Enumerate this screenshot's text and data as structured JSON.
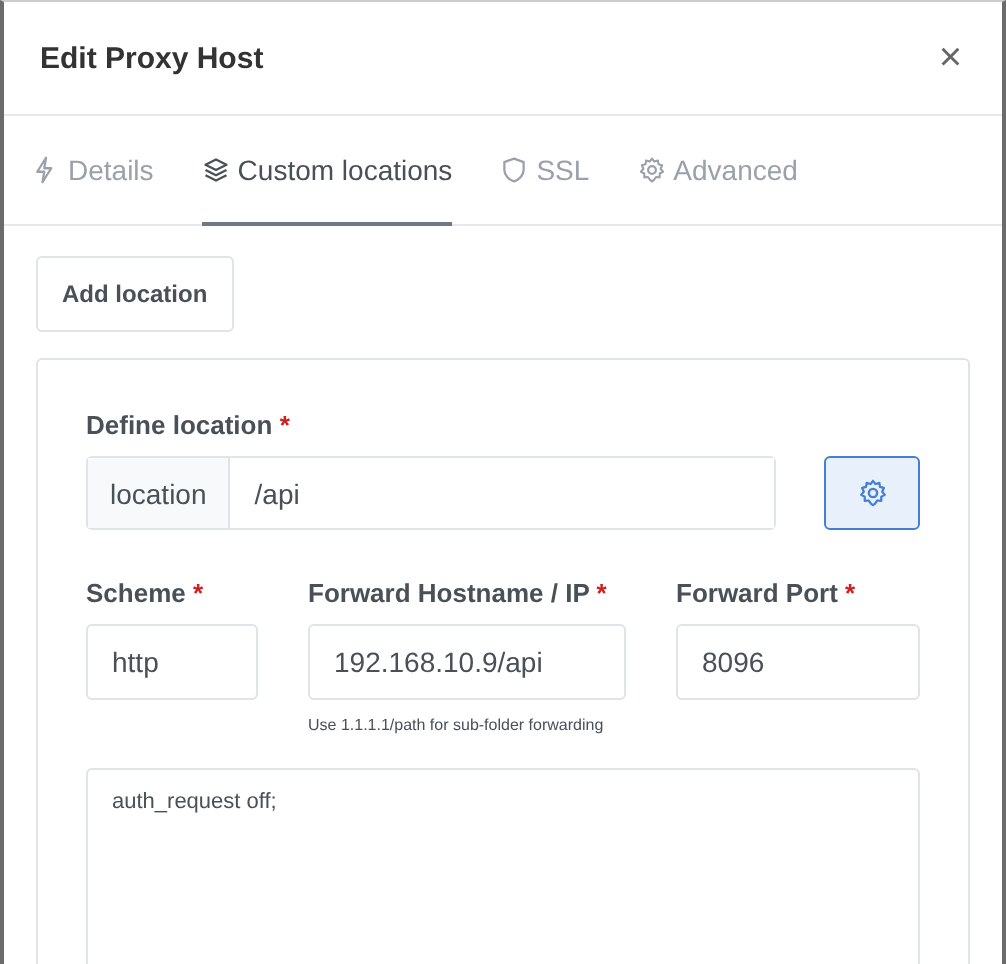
{
  "window": {
    "title": "Edit Proxy Host",
    "close": "×"
  },
  "tabs": [
    {
      "label": "Details",
      "selected": false
    },
    {
      "label": "Custom locations",
      "selected": true
    },
    {
      "label": "SSL",
      "selected": false
    },
    {
      "label": "Advanced",
      "selected": false
    }
  ],
  "add_button": "Add location",
  "location": {
    "label": "Define location",
    "required": "*",
    "prefix": "location",
    "value": "/api"
  },
  "fields": [
    {
      "label": "Scheme",
      "required": "*",
      "value": "http"
    },
    {
      "label": "Forward Hostname / IP",
      "required": "*",
      "value": "192.168.10.9/api",
      "help": "Use 1.1.1.1/path for sub-folder forwarding"
    },
    {
      "label": "Forward Port",
      "required": "*",
      "value": "8096"
    }
  ],
  "config": {
    "value": "auth_request off;"
  }
}
